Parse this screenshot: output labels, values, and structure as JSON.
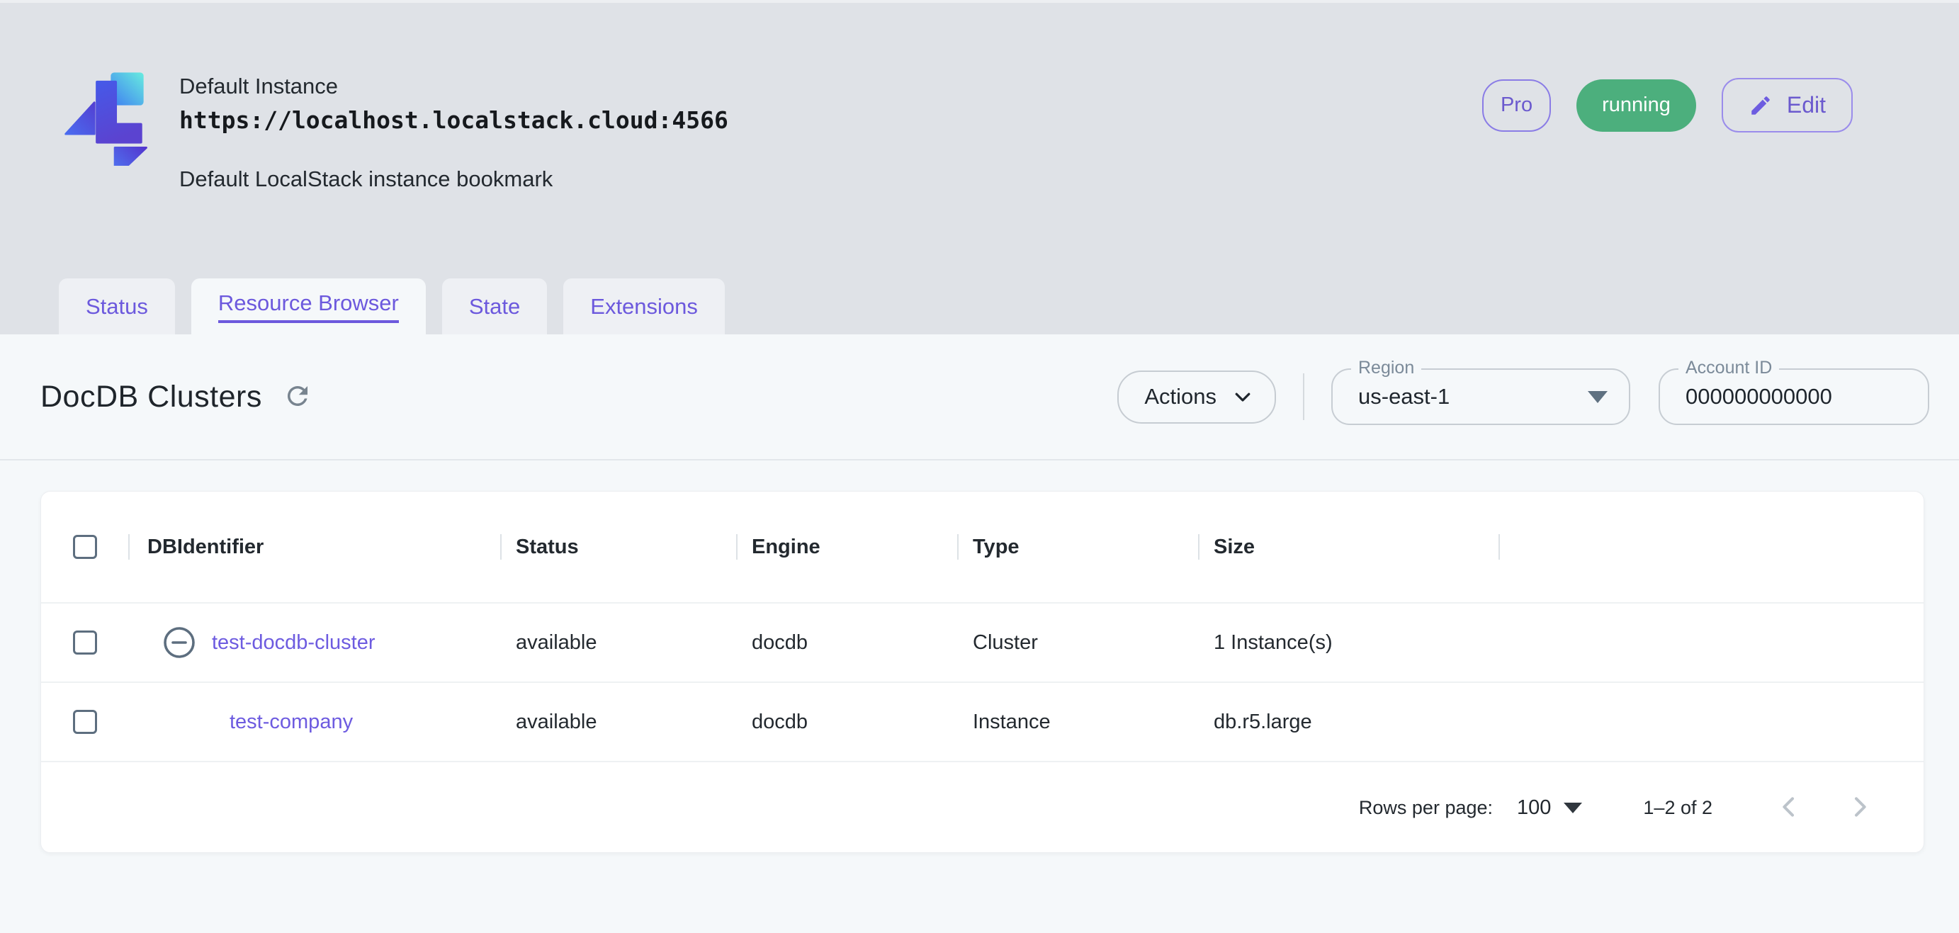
{
  "header": {
    "instance_name": "Default Instance",
    "instance_url": "https://localhost.localstack.cloud:4566",
    "instance_description": "Default LocalStack instance bookmark",
    "pro_badge": "Pro",
    "status_badge": "running",
    "edit_button": "Edit"
  },
  "tabs": [
    {
      "label": "Status",
      "active": false
    },
    {
      "label": "Resource Browser",
      "active": true
    },
    {
      "label": "State",
      "active": false
    },
    {
      "label": "Extensions",
      "active": false
    }
  ],
  "toolbar": {
    "title": "DocDB Clusters",
    "actions_button": "Actions",
    "region_label": "Region",
    "region_value": "us-east-1",
    "account_label": "Account ID",
    "account_value": "000000000000"
  },
  "table": {
    "columns": {
      "id": "DBIdentifier",
      "status": "Status",
      "engine": "Engine",
      "type": "Type",
      "size": "Size"
    },
    "rows": [
      {
        "id": "test-docdb-cluster",
        "status": "available",
        "engine": "docdb",
        "type": "Cluster",
        "size": "1 Instance(s)"
      },
      {
        "id": "test-company",
        "status": "available",
        "engine": "docdb",
        "type": "Instance",
        "size": "db.r5.large"
      }
    ]
  },
  "pagination": {
    "rows_per_page_label": "Rows per page:",
    "rows_per_page_value": "100",
    "range_label": "1–2 of 2"
  },
  "icons": {
    "logo": "localstack-logo",
    "edit": "pencil-icon",
    "refresh": "refresh-icon",
    "expand_toggle": "minus-circle-icon",
    "dropdown": "caret-down-icon",
    "prev": "chevron-left-icon",
    "next": "chevron-right-icon"
  },
  "colors": {
    "accent_purple": "#6c59dd",
    "link_purple": "#6d5be0",
    "running_green": "#4caf7d",
    "header_bg": "#dfe2e7",
    "content_bg": "#f5f8fa",
    "slate_icon": "#5d6e7f"
  }
}
